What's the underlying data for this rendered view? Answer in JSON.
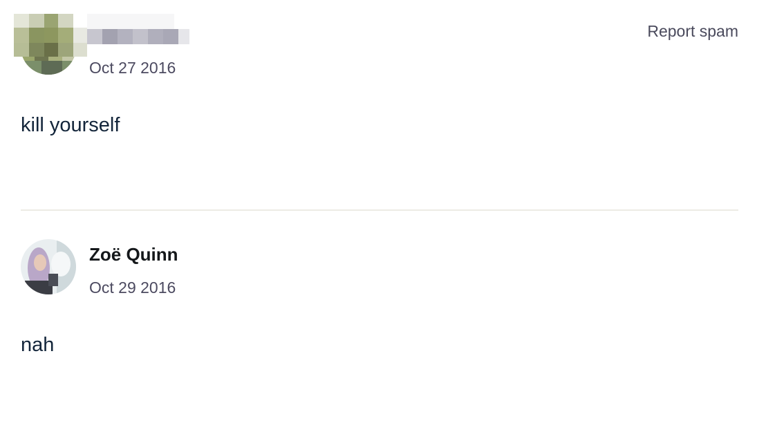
{
  "comments": [
    {
      "author": "",
      "date": "Oct 27 2016",
      "text": "kill yourself",
      "report_label": "Report spam",
      "avatar_icon": "pixelated-avatar-icon",
      "username_censored": true
    },
    {
      "author": "Zoë Quinn",
      "date": "Oct 29 2016",
      "text": "nah",
      "avatar_icon": "profile-photo-icon"
    }
  ],
  "colors": {
    "text_primary": "#13253a",
    "text_secondary": "#4c4a60",
    "divider": "#ecebe4"
  }
}
